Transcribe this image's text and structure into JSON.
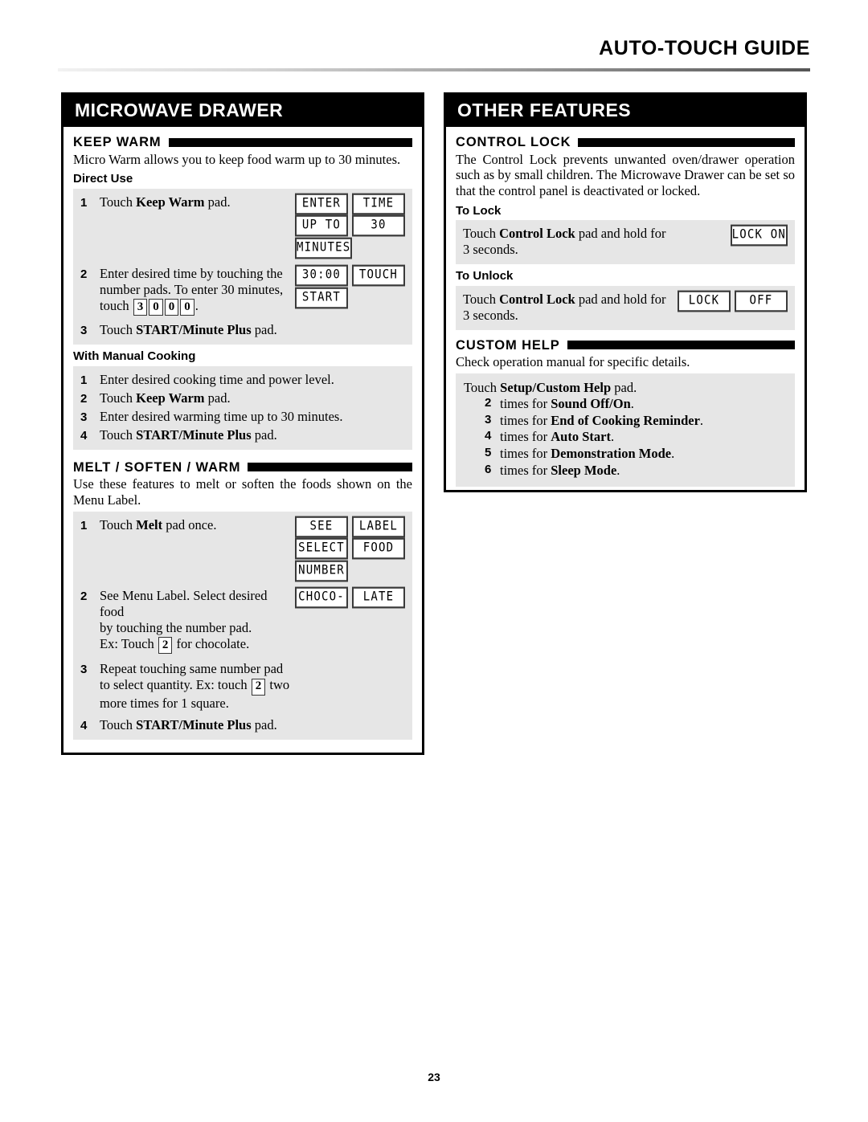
{
  "header": {
    "guide_title": "AUTO-TOUCH GUIDE"
  },
  "footer": {
    "page_number": "23"
  },
  "colors": {
    "panel_border": "#000000",
    "panel_title_bg": "#000000",
    "panel_title_fg": "#ffffff",
    "shaded_block": "#e6e6e6",
    "lcd_border": "#3a3a3a",
    "lcd_bg": "#ffffff"
  },
  "left_panel": {
    "title": "MICROWAVE DRAWER",
    "sections": [
      {
        "heading": "KEEP WARM",
        "intro": "Micro Warm allows you to keep food warm up to 30 minutes.",
        "sub_sections": [
          {
            "sub_heading": "Direct Use",
            "steps": [
              {
                "num": "1",
                "text_pre": "Touch ",
                "text_bold": "Keep Warm",
                "text_post": " pad.",
                "lcd_rows": [
                  [
                    "ENTER",
                    "TIME"
                  ],
                  [
                    "UP TO",
                    "30"
                  ],
                  [
                    "MINUTES"
                  ]
                ]
              },
              {
                "num": "2",
                "text_line1": "Enter desired time by touching the",
                "text_line2": "number pads. To enter 30 minutes,",
                "text_line3_pre": "touch ",
                "keys": [
                  "3",
                  "0",
                  "0",
                  "0"
                ],
                "text_line3_post": ".",
                "lcd_rows": [
                  [
                    "30:00",
                    "TOUCH"
                  ],
                  [
                    "START"
                  ]
                ]
              },
              {
                "num": "3",
                "text_pre": "Touch ",
                "text_bold": "START/Minute Plus",
                "text_post": " pad."
              }
            ]
          },
          {
            "sub_heading": "With Manual Cooking",
            "steps": [
              {
                "num": "1",
                "text_pre": "Enter desired cooking time and power level.",
                "text_bold": "",
                "text_post": ""
              },
              {
                "num": "2",
                "text_pre": "Touch ",
                "text_bold": "Keep Warm",
                "text_post": " pad."
              },
              {
                "num": "3",
                "text_pre": "Enter desired warming time up to 30 minutes.",
                "text_bold": "",
                "text_post": ""
              },
              {
                "num": "4",
                "text_pre": "Touch ",
                "text_bold": "START/Minute Plus",
                "text_post": " pad."
              }
            ]
          }
        ]
      },
      {
        "heading": "MELT / SOFTEN / WARM",
        "intro": "Use these features to melt or soften the foods shown on the Menu Label.",
        "steps": [
          {
            "num": "1",
            "text_pre": "Touch ",
            "text_bold": "Melt",
            "text_post": " pad once.",
            "lcd_rows": [
              [
                "SEE",
                "LABEL"
              ],
              [
                "SELECT",
                "FOOD"
              ],
              [
                "NUMBER"
              ]
            ]
          },
          {
            "num": "2",
            "text_line1": "See Menu Label. Select desired food",
            "text_line2": "by touching the number pad.",
            "text_line3_pre": "Ex: Touch ",
            "key": "2",
            "text_line3_post": " for chocolate.",
            "lcd_rows": [
              [
                "CHOCO-",
                "LATE"
              ]
            ]
          },
          {
            "num": "3",
            "text_line1": "Repeat touching same number pad",
            "text_line2_pre": "to select quantity. Ex: touch ",
            "key": "2",
            "text_line2_post": " two",
            "text_line3": "more times for 1 square."
          },
          {
            "num": "4",
            "text_pre": "Touch ",
            "text_bold": "START/Minute Plus",
            "text_post": " pad."
          }
        ]
      }
    ]
  },
  "right_panel": {
    "title": "OTHER FEATURES",
    "control_lock": {
      "heading": "CONTROL LOCK",
      "intro": "The Control Lock prevents unwanted oven/drawer operation such as by small children. The Microwave Drawer can be set so that the control panel is deactivated or locked.",
      "to_lock": {
        "sub_heading": "To Lock",
        "text_pre": "Touch ",
        "text_bold": "Control Lock",
        "text_post": " pad and hold for",
        "text_line2": "3 seconds.",
        "lcd_rows": [
          [
            "LOCK ON"
          ]
        ]
      },
      "to_unlock": {
        "sub_heading": "To Unlock",
        "text_pre": "Touch ",
        "text_bold": "Control Lock",
        "text_post": " pad and hold for",
        "text_line2": "3 seconds.",
        "lcd_rows": [
          [
            "LOCK",
            "OFF"
          ]
        ]
      }
    },
    "custom_help": {
      "heading": "CUSTOM HELP",
      "intro": "Check operation manual for specific details.",
      "lead_pre": "Touch ",
      "lead_bold": "Setup/Custom Help",
      "lead_post": " pad.",
      "items": [
        {
          "num": "2",
          "pre": "times for ",
          "bold": "Sound Off/On",
          "post": "."
        },
        {
          "num": "3",
          "pre": "times for ",
          "bold": "End of Cooking Reminder",
          "post": "."
        },
        {
          "num": "4",
          "pre": "times for ",
          "bold": "Auto Start",
          "post": "."
        },
        {
          "num": "5",
          "pre": "times for ",
          "bold": "Demonstration Mode",
          "post": "."
        },
        {
          "num": "6",
          "pre": "times for ",
          "bold": "Sleep Mode",
          "post": "."
        }
      ]
    }
  }
}
